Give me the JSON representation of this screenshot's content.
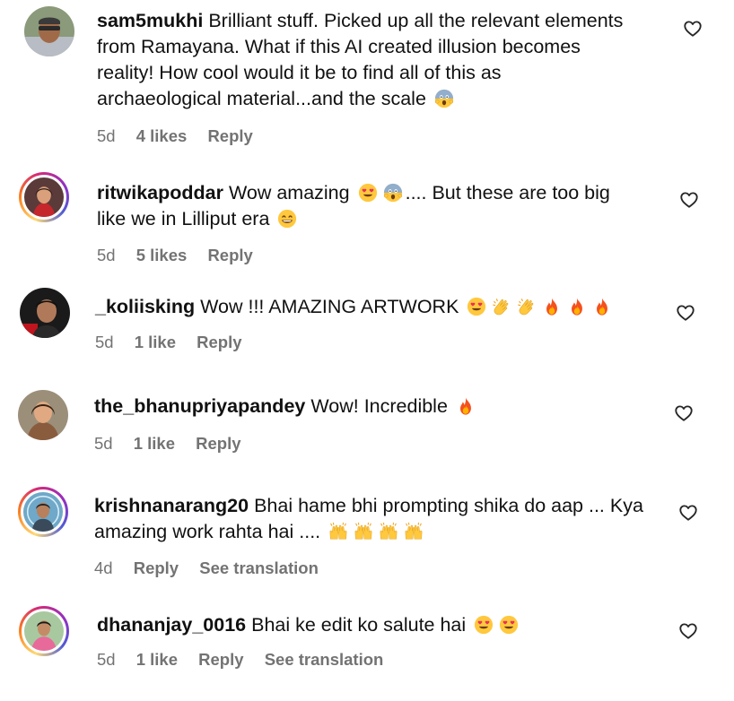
{
  "comments": [
    {
      "username": "sam5mukhi",
      "text_lines": [
        "Brilliant stuff. Picked up all the relevant elements",
        "from Ramayana. What if this AI created illusion becomes",
        "reality! How cool would it be to find all of this as",
        "archaeological material...and the scale"
      ],
      "emojis": [
        "screaming-face-emoji"
      ],
      "time": "5d",
      "likes": "4 likes",
      "reply": "Reply"
    },
    {
      "username": "ritwikapoddar",
      "text_a": "Wow amazing",
      "text_b": ".... But these are too big",
      "text_c": "like we in Lilliput era",
      "emojis": [
        "heart-eyes-emoji",
        "screaming-face-emoji",
        "grinning-face-emoji"
      ],
      "time": "5d",
      "likes": "5 likes",
      "reply": "Reply"
    },
    {
      "username": "_koliisking",
      "text": "Wow !!! AMAZING ARTWORK",
      "emojis": [
        "heart-eyes-emoji",
        "clapping-hands-emoji",
        "clapping-hands-emoji",
        "fire-emoji",
        "fire-emoji",
        "fire-emoji"
      ],
      "time": "5d",
      "likes": "1 like",
      "reply": "Reply"
    },
    {
      "username": "the_bhanupriyapandey",
      "text": "Wow! Incredible",
      "emojis": [
        "fire-emoji"
      ],
      "time": "5d",
      "likes": "1 like",
      "reply": "Reply"
    },
    {
      "username": "krishnanarang20",
      "text_lines": [
        "Bhai hame bhi prompting shika do aap ... Kya",
        "amazing work rahta hai ...."
      ],
      "emojis": [
        "raising-hands-emoji",
        "raising-hands-emoji",
        "raising-hands-emoji",
        "raising-hands-emoji"
      ],
      "time": "4d",
      "reply": "Reply",
      "translate": "See translation"
    },
    {
      "username": "dhananjay_0016",
      "text": "Bhai ke edit ko salute hai",
      "emojis": [
        "heart-eyes-emoji",
        "heart-eyes-emoji"
      ],
      "time": "5d",
      "likes": "1 like",
      "reply": "Reply",
      "translate": "See translation"
    }
  ],
  "colors": {
    "text": "#111111",
    "meta": "#737373",
    "background": "#ffffff"
  },
  "icons": {
    "like": "heart-outline-icon"
  }
}
